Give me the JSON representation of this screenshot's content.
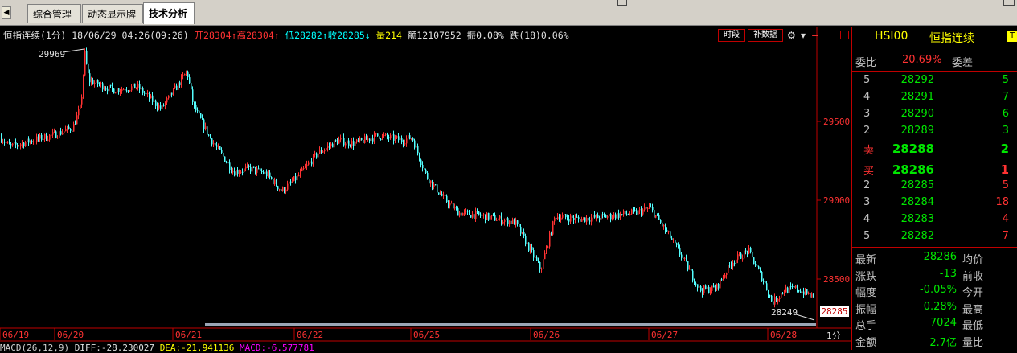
{
  "tabs": [
    {
      "label": "综合管理"
    },
    {
      "label": "动态显示牌"
    },
    {
      "label": "技术分析"
    }
  ],
  "header": {
    "name": "恒指连续(1分)",
    "datetime": "18/06/29 04:26(09:26)",
    "open": "开28304↑",
    "high": "高28304↑",
    "low": "低28282↑",
    "close": "收28285↓",
    "volume": "量214",
    "amount": "额12107952",
    "amplitude": "振0.08%",
    "change": "跌(18)0.06%",
    "btn_time": "时段",
    "btn_fill": "补数据"
  },
  "price_axis": {
    "ticks": [
      "29500",
      "29000",
      "28500"
    ],
    "current": "28285"
  },
  "annotations": {
    "max_label": "29969",
    "min_label": "28249"
  },
  "date_axis": {
    "labels": [
      "06/19",
      "06/20",
      "06/21",
      "06/22",
      "06/25",
      "06/26",
      "06/27",
      "06/28"
    ],
    "period": "1分"
  },
  "macd_line": {
    "label": "MACD(26,12,9)",
    "diff": "DIFF:-28.230027",
    "dea": "DEA:-21.941136",
    "macd": "MACD:-6.577781"
  },
  "quote": {
    "code": "HSI00",
    "name": "恒指连续",
    "ratio_label": "委比",
    "ratio_value": "20.69%",
    "diff_label": "委差",
    "sell": [
      {
        "level": "5",
        "price": "28292",
        "vol": "5"
      },
      {
        "level": "4",
        "price": "28291",
        "vol": "7"
      },
      {
        "level": "3",
        "price": "28290",
        "vol": "6"
      },
      {
        "level": "2",
        "price": "28289",
        "vol": "3"
      },
      {
        "level": "卖",
        "price": "28288",
        "vol": "2"
      }
    ],
    "buy": [
      {
        "level": "买",
        "price": "28286",
        "vol": "1"
      },
      {
        "level": "2",
        "price": "28285",
        "vol": "5"
      },
      {
        "level": "3",
        "price": "28284",
        "vol": "18"
      },
      {
        "level": "4",
        "price": "28283",
        "vol": "4"
      },
      {
        "level": "5",
        "price": "28282",
        "vol": "7"
      }
    ],
    "stats": [
      {
        "label": "最新",
        "value": "28286",
        "label2": "均价"
      },
      {
        "label": "涨跌",
        "value": "-13",
        "label2": "前收"
      },
      {
        "label": "幅度",
        "value": "-0.05%",
        "label2": "今开"
      },
      {
        "label": "振幅",
        "value": "0.28%",
        "label2": "最高"
      },
      {
        "label": "总手",
        "value": "7024",
        "label2": "最低"
      },
      {
        "label": "金额",
        "value": "2.7亿",
        "label2": "量比"
      }
    ]
  },
  "chart_data": {
    "type": "candlestick",
    "y_ticks": [
      29500,
      29000,
      28500
    ],
    "anchors": [
      [
        0,
        29400
      ],
      [
        12,
        29340
      ],
      [
        40,
        29380
      ],
      [
        70,
        29420
      ],
      [
        90,
        29460
      ],
      [
        100,
        29600
      ],
      [
        105,
        29930
      ],
      [
        110,
        29760
      ],
      [
        140,
        29700
      ],
      [
        170,
        29720
      ],
      [
        200,
        29580
      ],
      [
        222,
        29740
      ],
      [
        232,
        29820
      ],
      [
        240,
        29600
      ],
      [
        260,
        29400
      ],
      [
        290,
        29180
      ],
      [
        310,
        29200
      ],
      [
        330,
        29170
      ],
      [
        350,
        29060
      ],
      [
        370,
        29150
      ],
      [
        395,
        29300
      ],
      [
        420,
        29380
      ],
      [
        440,
        29360
      ],
      [
        470,
        29410
      ],
      [
        500,
        29380
      ],
      [
        512,
        29400
      ],
      [
        530,
        29150
      ],
      [
        550,
        29020
      ],
      [
        570,
        28920
      ],
      [
        600,
        28900
      ],
      [
        640,
        28860
      ],
      [
        672,
        28560
      ],
      [
        690,
        28900
      ],
      [
        720,
        28880
      ],
      [
        760,
        28900
      ],
      [
        790,
        28920
      ],
      [
        808,
        28950
      ],
      [
        830,
        28790
      ],
      [
        850,
        28620
      ],
      [
        870,
        28430
      ],
      [
        890,
        28440
      ],
      [
        910,
        28610
      ],
      [
        930,
        28680
      ],
      [
        950,
        28480
      ],
      [
        960,
        28350
      ],
      [
        975,
        28430
      ],
      [
        990,
        28440
      ],
      [
        1013,
        28380
      ]
    ],
    "date_label_x": [
      0,
      68,
      215,
      366,
      511,
      660,
      807,
      955
    ]
  }
}
